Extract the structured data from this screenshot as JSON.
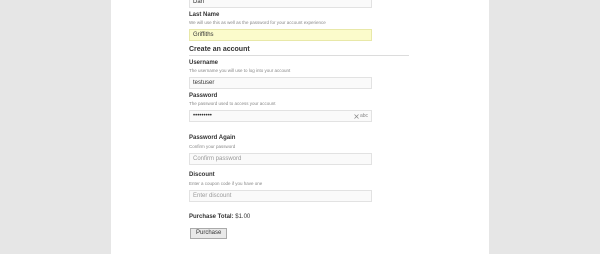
{
  "first_name": {
    "value": "Dan"
  },
  "last_name": {
    "label": "Last Name",
    "help": "We will use this as well as the password for your account experience",
    "value": "Griffiths"
  },
  "section": {
    "title": "Create an account"
  },
  "username": {
    "label": "Username",
    "help": "The username you will use to log into your account",
    "value": "testuser"
  },
  "password": {
    "label": "Password",
    "help": "The password used to access your account",
    "value": "•••••••••",
    "toggle_label": "abc",
    "toggle_icon": "hide-password-icon"
  },
  "password_again": {
    "label": "Password Again",
    "help": "Confirm your password",
    "placeholder": "Confirm password"
  },
  "discount": {
    "label": "Discount",
    "help": "Enter a coupon code if you have one",
    "placeholder": "Enter discount"
  },
  "purchase": {
    "total_label": "Purchase Total:",
    "total_value": "$1.00",
    "button_label": "Purchase"
  }
}
